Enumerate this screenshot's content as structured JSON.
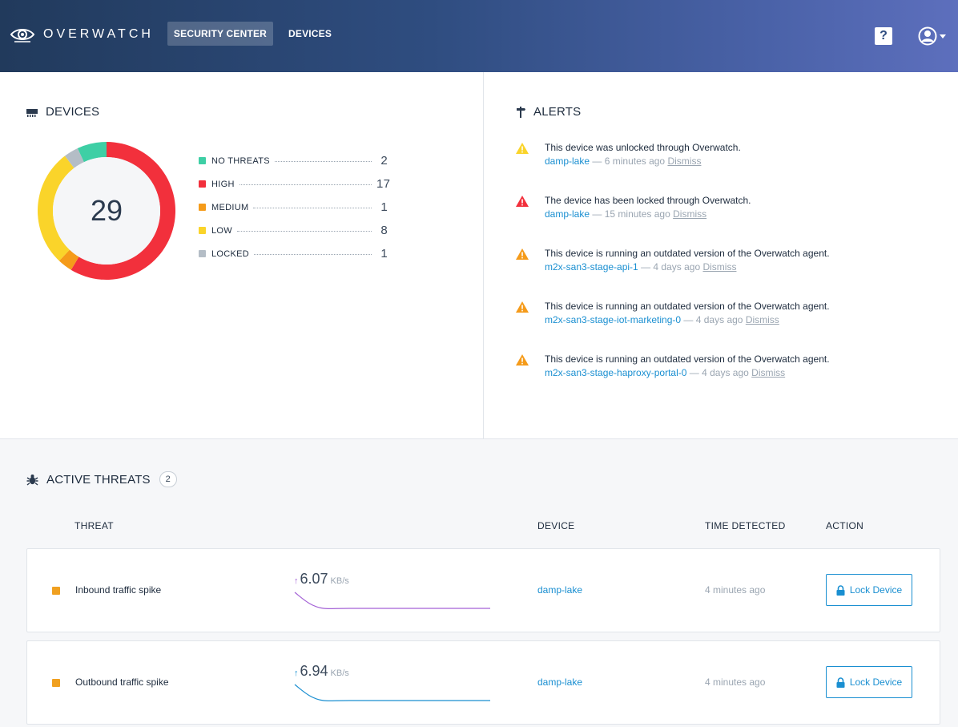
{
  "header": {
    "logo_text": "OVERWATCH",
    "nav": [
      {
        "label": "SECURITY CENTER",
        "active": true
      },
      {
        "label": "DEVICES",
        "active": false
      }
    ],
    "help_label": "?"
  },
  "devices": {
    "title": "DEVICES",
    "total": "29",
    "legend": [
      {
        "label": "NO THREATS",
        "value": 2,
        "color": "#3ecfa5"
      },
      {
        "label": "HIGH",
        "value": 17,
        "color": "#f2303c"
      },
      {
        "label": "MEDIUM",
        "value": 1,
        "color": "#f59b1a"
      },
      {
        "label": "LOW",
        "value": 8,
        "color": "#fad42a"
      },
      {
        "label": "LOCKED",
        "value": 1,
        "color": "#b4bdc6"
      }
    ]
  },
  "alerts": {
    "title": "ALERTS",
    "items": [
      {
        "message": "This device was unlocked through Overwatch.",
        "device": "damp-lake",
        "time": "6 minutes ago",
        "dismiss": "Dismiss",
        "level_color": "#fad42a"
      },
      {
        "message": "The device has been locked through Overwatch.",
        "device": "damp-lake",
        "time": "15 minutes ago",
        "dismiss": "Dismiss",
        "level_color": "#f2303c"
      },
      {
        "message": "This device is running an outdated version of the Overwatch agent.",
        "device": "m2x-san3-stage-api-1",
        "time": "4 days ago",
        "dismiss": "Dismiss",
        "level_color": "#f59b1a"
      },
      {
        "message": "This device is running an outdated version of the Overwatch agent.",
        "device": "m2x-san3-stage-iot-marketing-0",
        "time": "4 days ago",
        "dismiss": "Dismiss",
        "level_color": "#f59b1a"
      },
      {
        "message": "This device is running an outdated version of the Overwatch agent.",
        "device": "m2x-san3-stage-haproxy-portal-0",
        "time": "4 days ago",
        "dismiss": "Dismiss",
        "level_color": "#f59b1a"
      }
    ],
    "separator": "—"
  },
  "threats": {
    "title": "ACTIVE THREATS",
    "count": "2",
    "columns": {
      "threat": "THREAT",
      "device": "DEVICE",
      "time": "TIME DETECTED",
      "action": "ACTION"
    },
    "rows": [
      {
        "name": "Inbound traffic spike",
        "rate": "6.07",
        "unit": "KB/s",
        "arrow": "↑",
        "color": "#a462d6",
        "device": "damp-lake",
        "time": "4 minutes ago",
        "action": "Lock Device"
      },
      {
        "name": "Outbound traffic spike",
        "rate": "6.94",
        "unit": "KB/s",
        "arrow": "↑",
        "color": "#1a8fd1",
        "device": "damp-lake",
        "time": "4 minutes ago",
        "action": "Lock Device"
      }
    ]
  }
}
